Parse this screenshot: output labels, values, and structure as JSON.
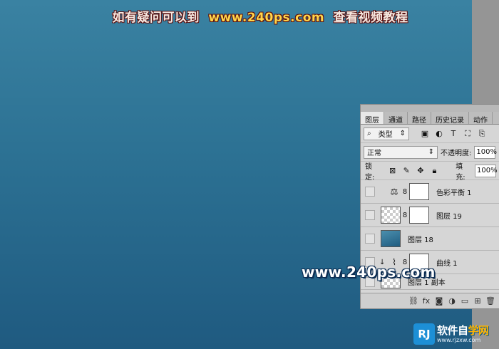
{
  "caption": {
    "part1": "如有疑问可以到",
    "part2": "www.240ps.com",
    "part3": "查看视频教程"
  },
  "panel": {
    "tabs": [
      "图层",
      "通道",
      "路径",
      "历史记录",
      "动作"
    ],
    "filter": {
      "label": "类型",
      "icons": [
        "image-filter-icon",
        "adjust-filter-icon",
        "text-filter-icon",
        "shape-filter-icon",
        "smart-filter-icon"
      ]
    },
    "blend": {
      "mode": "正常",
      "opacity_label": "不透明度:",
      "opacity_value": "100%"
    },
    "lock": {
      "label": "锁定:",
      "fill_label": "填充:",
      "fill_value": "100%"
    },
    "layers": [
      {
        "name": "色彩平衡 1",
        "type": "adjustment"
      },
      {
        "name": "图层 19",
        "type": "mask"
      },
      {
        "name": "图层 18",
        "type": "image"
      },
      {
        "name": "曲线 1",
        "type": "curves"
      },
      {
        "name": "图层 1 副本",
        "type": "copy"
      }
    ]
  },
  "watermark": {
    "text": "www.240ps.com"
  },
  "logo": {
    "badge": "RJ",
    "name_a": "软件自",
    "name_b": "学网",
    "url": "www.rjzxw.com"
  }
}
